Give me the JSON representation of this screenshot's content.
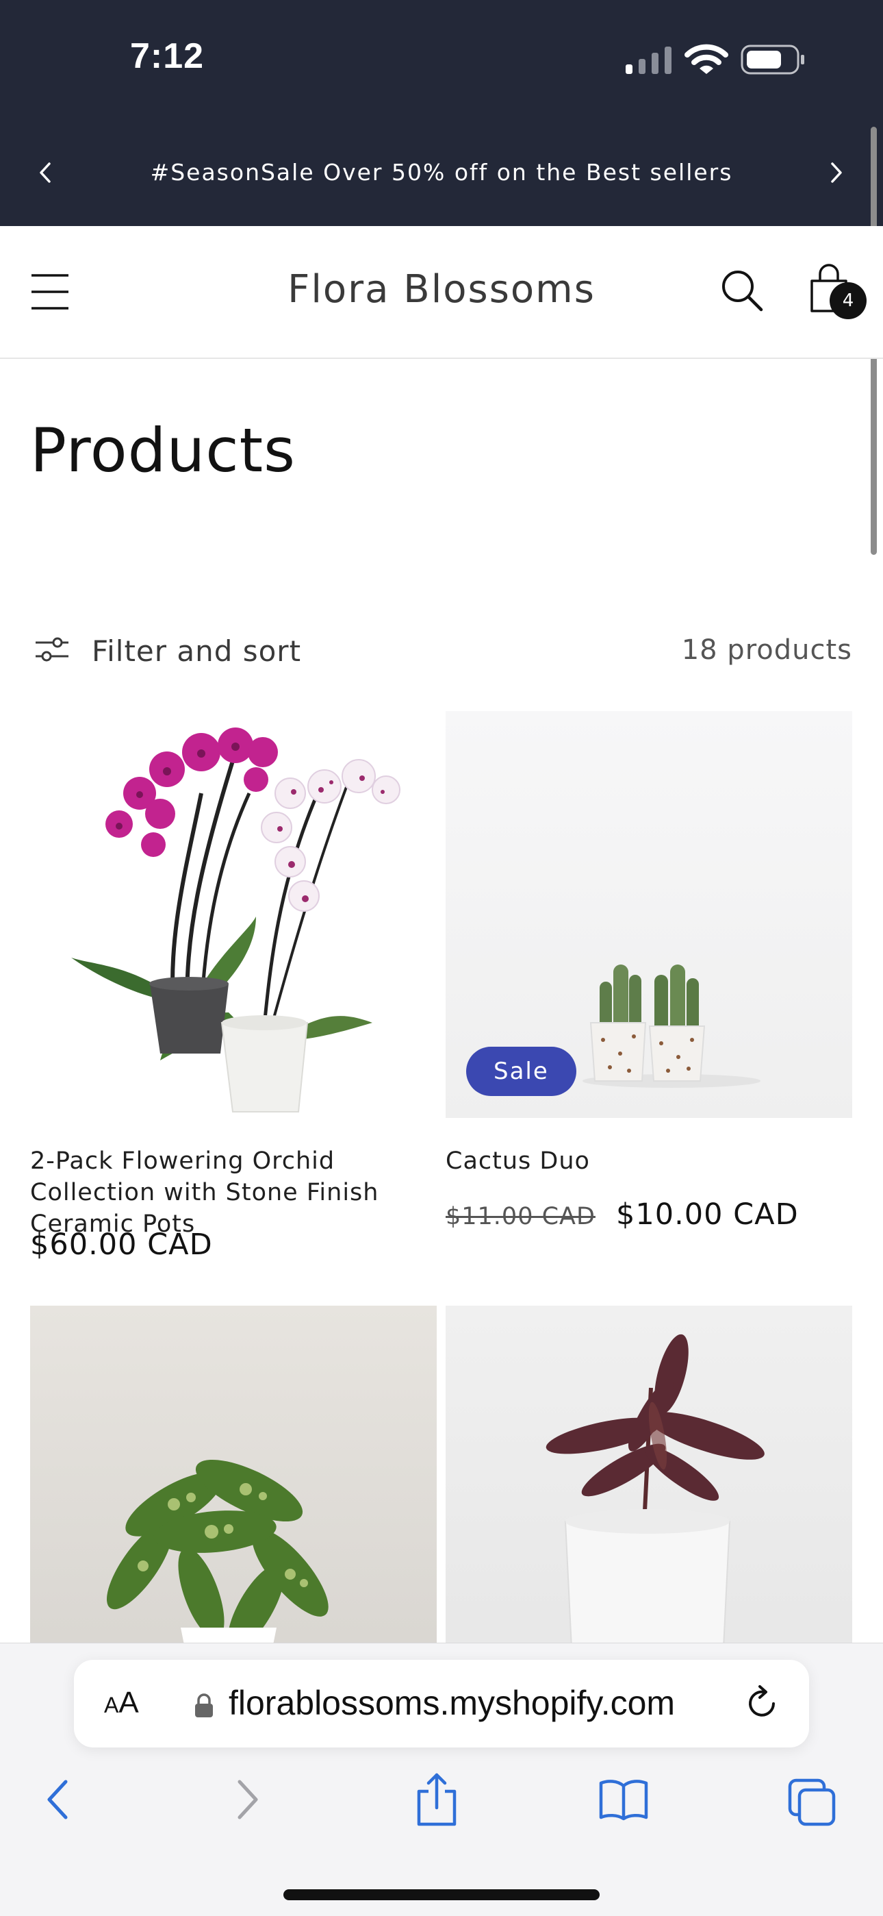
{
  "status_bar": {
    "time": "7:12",
    "icons": [
      "cellular-signal-icon",
      "wifi-icon",
      "battery-icon"
    ]
  },
  "announcement": {
    "text": "#SeasonSale Over 50% off on the Best sellers",
    "prev_icon": "chevron-left-icon",
    "next_icon": "chevron-right-icon"
  },
  "header": {
    "store_name": "Flora Blossoms",
    "menu_icon": "hamburger-menu-icon",
    "search_icon": "search-icon",
    "cart_icon": "shopping-bag-icon",
    "cart_count": "4"
  },
  "page": {
    "title": "Products",
    "filter_label": "Filter and sort",
    "product_count": "18 products"
  },
  "products": [
    {
      "title": "2-Pack Flowering Orchid Collection with Stone Finish Ceramic Pots",
      "price": "$60.00 CAD",
      "image": "orchids-image"
    },
    {
      "title": "Cactus Duo",
      "badge": "Sale",
      "compare_price": "$11.00 CAD",
      "price": "$10.00 CAD",
      "image": "cactus-image"
    },
    {
      "image": "dieffenbachia-image"
    },
    {
      "image": "rubber-plant-image"
    }
  ],
  "browser": {
    "text_size_label": "AA",
    "url": "florablossoms.myshopify.com",
    "toolbar_icons": [
      "back-icon",
      "forward-icon",
      "share-icon",
      "bookmarks-icon",
      "tabs-icon"
    ]
  },
  "colors": {
    "header_bg": "#232838",
    "sale_badge": "#3b48b1",
    "safari_accent": "#2f6fd8"
  }
}
